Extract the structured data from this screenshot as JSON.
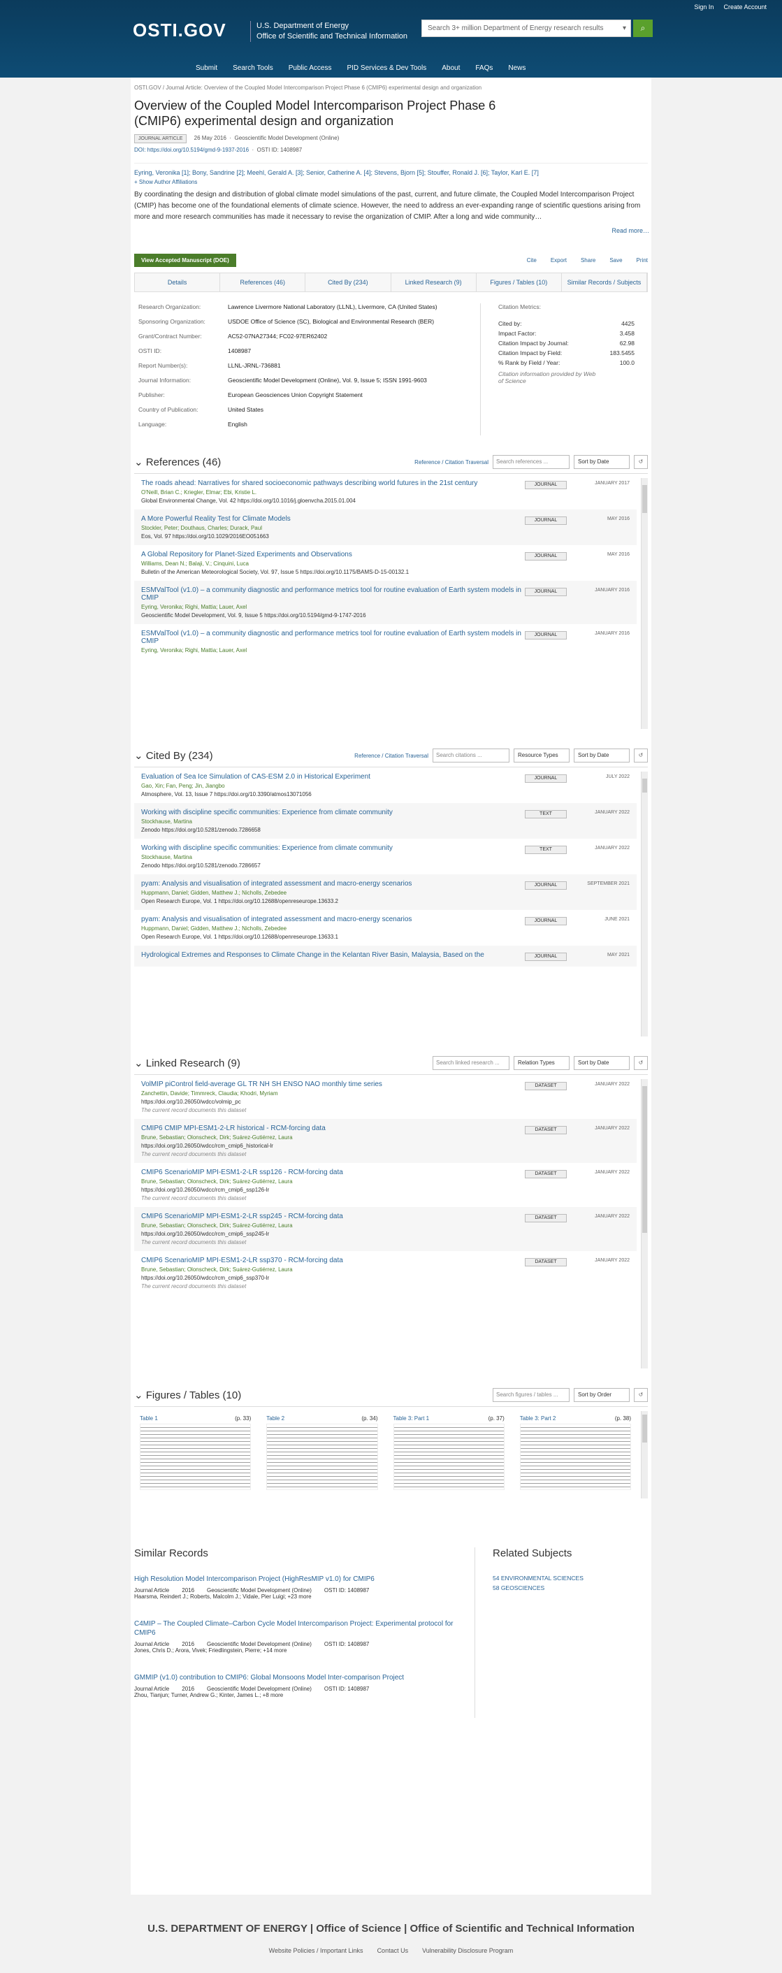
{
  "header": {
    "sign_in": "Sign In",
    "create_account": "Create Account",
    "logo": "OSTI.GOV",
    "agency1": "U.S. Department of Energy",
    "agency2": "Office of Scientific and Technical Information",
    "search_placeholder": "Search 3+ million Department of Energy research results",
    "nav": [
      "Submit",
      "Search Tools",
      "Public Access",
      "PID Services & Dev Tools",
      "About",
      "FAQs",
      "News"
    ]
  },
  "crumb": "OSTI.GOV  /  Journal Article: Overview of the Coupled Model Intercomparison Project Phase 6 (CMIP6) experimental design and organization",
  "title": "Overview of the Coupled Model Intercomparison Project Phase 6 (CMIP6) experimental design and organization",
  "meta": {
    "type": "JOURNAL ARTICLE",
    "date": "26 May 2016",
    "journal": "Geoscientific Model Development (Online)",
    "doi": "DOI: https://doi.org/10.5194/gmd-9-1937-2016",
    "osti": "OSTI ID: 1408987"
  },
  "authors": "Eyring, Veronika [1]; Bony, Sandrine [2]; Meehl, Gerald A. [3]; Senior, Catherine A. [4]; Stevens, Bjorn [5]; Stouffer, Ronald J. [6]; Taylor, Karl E. [7]",
  "show_aff": "+ Show Author Affiliations",
  "abstract": "By coordinating the design and distribution of global climate model simulations of the past, current, and future climate, the Coupled Model Intercomparison Project (CMIP) has become one of the foundational elements of climate science. However, the need to address an ever-expanding range of scientific questions arising from more and more research communities has made it necessary to revise the organization of CMIP. After a long and wide community…",
  "read_more": "Read more…",
  "view_btn": "View Accepted Manuscript (DOE)",
  "tools": [
    "Cite",
    "Export",
    "Share",
    "Save",
    "Print"
  ],
  "tabs": [
    "Details",
    "References (46)",
    "Cited By (234)",
    "Linked Research (9)",
    "Figures / Tables (10)",
    "Similar Records / Subjects"
  ],
  "details": [
    [
      "Research Organization:",
      "Lawrence Livermore National Laboratory (LLNL), Livermore, CA (United States)"
    ],
    [
      "Sponsoring Organization:",
      "USDOE Office of Science (SC), Biological and Environmental Research (BER)"
    ],
    [
      "Grant/Contract Number:",
      "AC52-07NA27344; FC02-97ER62402"
    ],
    [
      "OSTI ID:",
      "1408987"
    ],
    [
      "Report Number(s):",
      "LLNL-JRNL-736881"
    ],
    [
      "Journal Information:",
      "Geoscientific Model Development (Online), Vol. 9, Issue 5; ISSN 1991-9603"
    ],
    [
      "Publisher:",
      "European Geosciences Union     Copyright Statement"
    ],
    [
      "Country of Publication:",
      "United States"
    ],
    [
      "Language:",
      "English"
    ]
  ],
  "metrics": {
    "title": "Citation Metrics:",
    "rows": [
      [
        "Cited by:",
        "4425"
      ],
      [
        "Impact Factor:",
        "3.458"
      ],
      [
        "Citation Impact by Journal:",
        "62.98"
      ],
      [
        "Citation Impact by Field:",
        "183.5455"
      ],
      [
        "% Rank by Field / Year:",
        "100.0"
      ]
    ],
    "note": "Citation information provided by Web of Science"
  },
  "refs": {
    "title": "References (46)",
    "traversal": "Reference / Citation Traversal",
    "search": "Search references ...",
    "sort": "Sort by Date",
    "items": [
      {
        "t": "The roads ahead: Narratives for shared socioeconomic pathways describing world futures in the 21st century",
        "au": "O'Neill, Brian C.; Kriegler, Elmar; Ebi, Kristie L.",
        "j": "Global Environmental Change, Vol. 42    https://doi.org/10.1016/j.gloenvcha.2015.01.004",
        "k": "JOURNAL",
        "d": "JANUARY 2017"
      },
      {
        "t": "A More Powerful Reality Test for Climate Models",
        "au": "Stockler, Peter; Douthaus, Charles; Durack, Paul",
        "j": "Eos, Vol. 97    https://doi.org/10.1029/2016EO051663",
        "k": "JOURNAL",
        "d": "MAY 2016"
      },
      {
        "t": "A Global Repository for Planet-Sized Experiments and Observations",
        "au": "Williams, Dean N.; Balaji, V.; Cinquini, Luca",
        "j": "Bulletin of the American Meteorological Society, Vol. 97, Issue 5    https://doi.org/10.1175/BAMS-D-15-00132.1",
        "k": "JOURNAL",
        "d": "MAY 2016"
      },
      {
        "t": "ESMValTool (v1.0) – a community diagnostic and performance metrics tool for routine evaluation of Earth system models in CMIP",
        "au": "Eyring, Veronika; Righi, Mattia; Lauer, Axel",
        "j": "Geoscientific Model Development, Vol. 9, Issue 5    https://doi.org/10.5194/gmd-9-1747-2016",
        "k": "JOURNAL",
        "d": "JANUARY 2016"
      },
      {
        "t": "ESMValTool (v1.0) – a community diagnostic and performance metrics tool for routine evaluation of Earth system models in CMIP",
        "au": "Eyring, Veronika; Righi, Mattia; Lauer, Axel",
        "j": "",
        "k": "JOURNAL",
        "d": "JANUARY 2016"
      }
    ]
  },
  "cited": {
    "title": "Cited By (234)",
    "traversal": "Reference / Citation Traversal",
    "search": "Search citations ...",
    "type": "Resource Types",
    "sort": "Sort by Date",
    "items": [
      {
        "t": "Evaluation of Sea Ice Simulation of CAS-ESM 2.0 in Historical Experiment",
        "au": "Gao, Xin; Fan, Peng; Jin, Jiangbo",
        "j": "Atmosphere, Vol. 13, Issue 7    https://doi.org/10.3390/atmos13071056",
        "k": "JOURNAL",
        "d": "JULY 2022"
      },
      {
        "t": "Working with discipline specific communities: Experience from climate community",
        "au": "Stockhause, Martina",
        "j": "Zenodo    https://doi.org/10.5281/zenodo.7286658",
        "k": "TEXT",
        "d": "JANUARY 2022"
      },
      {
        "t": "Working with discipline specific communities: Experience from climate community",
        "au": "Stockhause, Martina",
        "j": "Zenodo    https://doi.org/10.5281/zenodo.7286657",
        "k": "TEXT",
        "d": "JANUARY 2022"
      },
      {
        "t": "pyam: Analysis and visualisation of integrated assessment and macro-energy scenarios",
        "au": "Huppmann, Daniel; Gidden, Matthew J.; Nicholls, Zebedee",
        "j": "Open Research Europe, Vol. 1    https://doi.org/10.12688/openreseurope.13633.2",
        "k": "JOURNAL",
        "d": "SEPTEMBER 2021"
      },
      {
        "t": "pyam: Analysis and visualisation of integrated assessment and macro-energy scenarios",
        "au": "Huppmann, Daniel; Gidden, Matthew J.; Nicholls, Zebedee",
        "j": "Open Research Europe, Vol. 1    https://doi.org/10.12688/openreseurope.13633.1",
        "k": "JOURNAL",
        "d": "JUNE 2021"
      },
      {
        "t": "Hydrological Extremes and Responses to Climate Change in the Kelantan River Basin, Malaysia, Based on the",
        "au": "",
        "j": "",
        "k": "JOURNAL",
        "d": "MAY 2021"
      }
    ]
  },
  "linked": {
    "title": "Linked Research (9)",
    "search": "Search linked research ...",
    "type": "Relation Types",
    "sort": "Sort by Date",
    "items": [
      {
        "t": "VolMIP piControl field-average GL TR NH SH ENSO NAO monthly time series",
        "au": "Zanchettin, Davide; Timmreck, Claudia; Khodri, Myriam",
        "j": "https://doi.org/10.26050/wdcc/volmip_pc",
        "k": "DATASET",
        "d": "JANUARY 2022",
        "n": "The current record documents this dataset"
      },
      {
        "t": "CMIP6 CMIP MPI-ESM1-2-LR historical - RCM-forcing data",
        "au": "Brune, Sebastian; Olonscheck, Dirk; Suárez-Gutiérrez, Laura",
        "j": "https://doi.org/10.26050/wdcc/rcm_cmip6_historical-lr",
        "k": "DATASET",
        "d": "JANUARY 2022",
        "n": "The current record documents this dataset"
      },
      {
        "t": "CMIP6 ScenarioMIP MPI-ESM1-2-LR ssp126 - RCM-forcing data",
        "au": "Brune, Sebastian; Olonscheck, Dirk; Suárez-Gutiérrez, Laura",
        "j": "https://doi.org/10.26050/wdcc/rcm_cmip6_ssp126-lr",
        "k": "DATASET",
        "d": "JANUARY 2022",
        "n": "The current record documents this dataset"
      },
      {
        "t": "CMIP6 ScenarioMIP MPI-ESM1-2-LR ssp245 - RCM-forcing data",
        "au": "Brune, Sebastian; Olonscheck, Dirk; Suárez-Gutiérrez, Laura",
        "j": "https://doi.org/10.26050/wdcc/rcm_cmip6_ssp245-lr",
        "k": "DATASET",
        "d": "JANUARY 2022",
        "n": "The current record documents this dataset"
      },
      {
        "t": "CMIP6 ScenarioMIP MPI-ESM1-2-LR ssp370 - RCM-forcing data",
        "au": "Brune, Sebastian; Olonscheck, Dirk; Suárez-Gutiérrez, Laura",
        "j": "https://doi.org/10.26050/wdcc/rcm_cmip6_ssp370-lr",
        "k": "DATASET",
        "d": "JANUARY 2022",
        "n": "The current record documents this dataset"
      }
    ]
  },
  "figures": {
    "title": "Figures / Tables (10)",
    "search": "Search figures / tables ...",
    "sort": "Sort by Order",
    "items": [
      [
        "Table 1",
        "(p. 33)"
      ],
      [
        "Table 2",
        "(p. 34)"
      ],
      [
        "Table 3: Part 1",
        "(p. 37)"
      ],
      [
        "Table 3: Part 2",
        "(p. 38)"
      ]
    ]
  },
  "similar": {
    "title": "Similar Records",
    "items": [
      {
        "t": "High Resolution Model Intercomparison Project (HighResMIP v1.0) for CMIP6",
        "m": [
          "Journal Article",
          "2016",
          "Geoscientific Model Development (Online)",
          "OSTI ID: 1408987"
        ],
        "a": "Haarsma, Reindert J.;  Roberts, Malcolm J.;  Vidale, Pier Luigi;  +23 more"
      },
      {
        "t": "C4MIP – The Coupled Climate–Carbon Cycle Model Intercomparison Project: Experimental protocol for CMIP6",
        "m": [
          "Journal Article",
          "2016",
          "Geoscientific Model Development (Online)",
          "OSTI ID: 1408987"
        ],
        "a": "Jones, Chris D.;  Arora, Vivek;  Friedlingstein, Pierre;  +14 more"
      },
      {
        "t": "GMMIP (v1.0) contribution to CMIP6: Global Monsoons Model Inter-comparison Project",
        "m": [
          "Journal Article",
          "2016",
          "Geoscientific Model Development (Online)",
          "OSTI ID: 1408987"
        ],
        "a": "Zhou, Tianjun;  Turner, Andrew G.;  Kinter, James L.;  +8 more"
      }
    ]
  },
  "subjects": {
    "title": "Related Subjects",
    "items": [
      "54 ENVIRONMENTAL SCIENCES",
      "58 GEOSCIENCES"
    ]
  },
  "footer": {
    "logo": "U.S. DEPARTMENT OF ENERGY | Office of Science | Office of Scientific and Technical Information",
    "links": [
      "Website Policies / Important Links",
      "Contact Us",
      "Vulnerability Disclosure Program"
    ]
  }
}
